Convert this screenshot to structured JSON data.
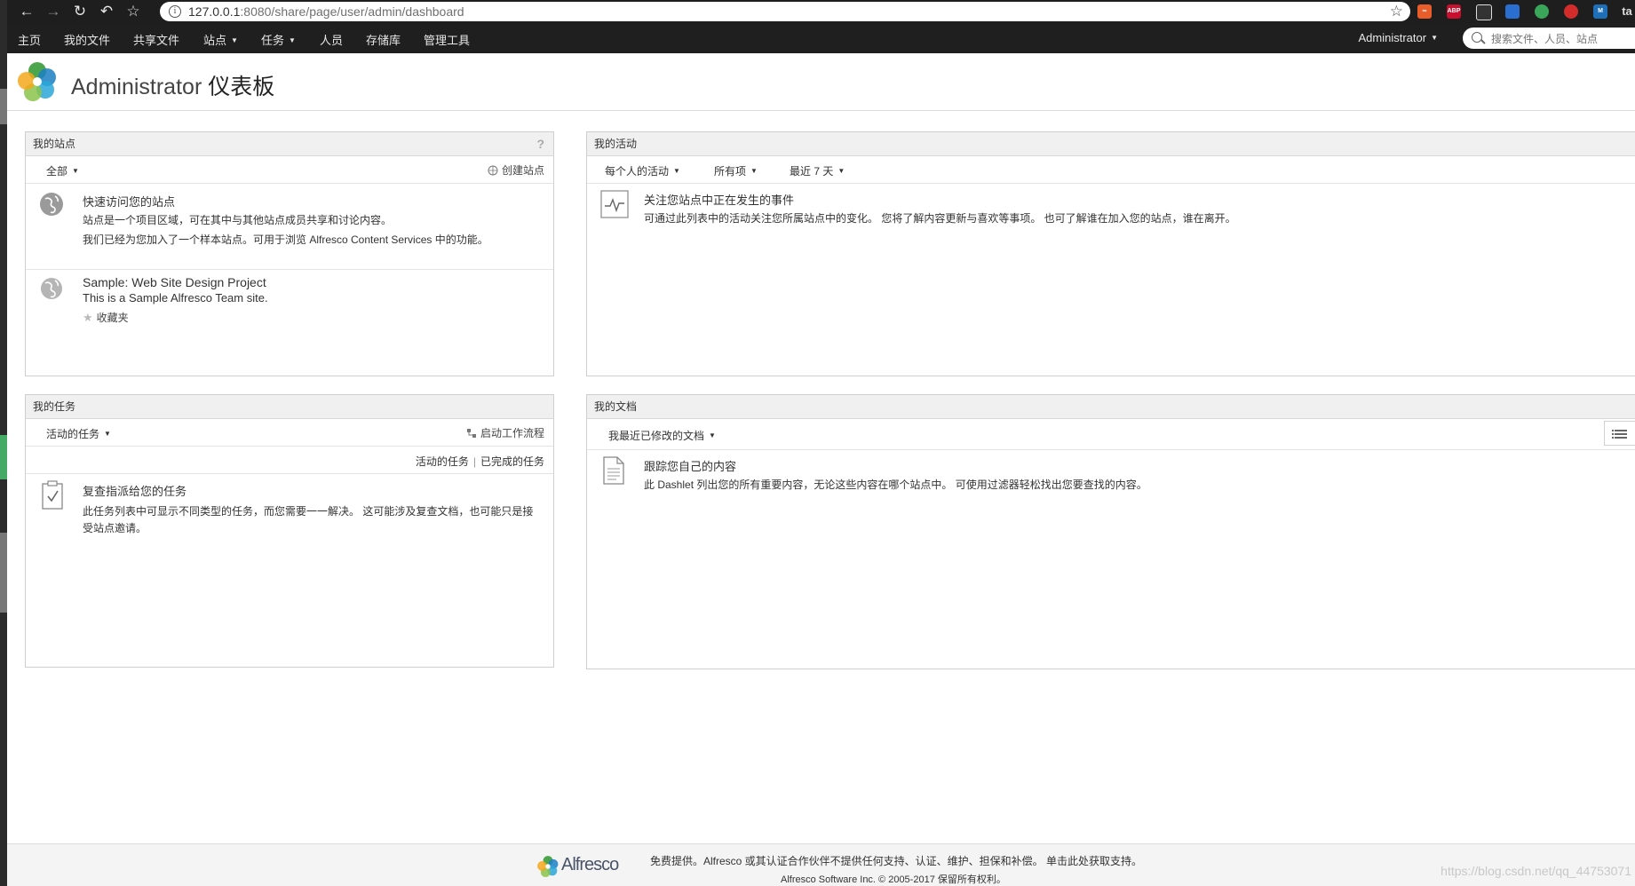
{
  "browser": {
    "url_host": "127.0.0.1",
    "url_path": ":8080/share/page/user/admin/dashboard",
    "ext_labels": [
      "∞",
      "ABP",
      "",
      "",
      "",
      "",
      "M",
      "ta"
    ]
  },
  "nav": {
    "items": [
      {
        "label": "主页"
      },
      {
        "label": "我的文件"
      },
      {
        "label": "共享文件"
      },
      {
        "label": "站点"
      },
      {
        "label": "任务"
      },
      {
        "label": "人员"
      },
      {
        "label": "存储库"
      },
      {
        "label": "管理工具"
      }
    ],
    "user": "Administrator",
    "search_placeholder": "搜索文件、人员、站点"
  },
  "title": {
    "user": "Administrator",
    "dashboard": "仪表板"
  },
  "my_sites": {
    "title": "我的站点",
    "help": "?",
    "filter": "全部",
    "create": "创建站点",
    "info_title": "快速访问您的站点",
    "info_desc1": "站点是一个项目区域，可在其中与其他站点成员共享和讨论内容。",
    "info_desc2": "我们已经为您加入了一个样本站点。可用于浏览 Alfresco Content Services 中的功能。",
    "site_name": "Sample: Web Site Design Project",
    "site_desc": "This is a Sample Alfresco Team site.",
    "favorite": "收藏夹"
  },
  "my_activities": {
    "title": "我的活动",
    "filter1": "每个人的活动",
    "filter2": "所有项",
    "filter3": "最近 7 天",
    "info_title": "关注您站点中正在发生的事件",
    "info_desc": "可通过此列表中的活动关注您所属站点中的变化。 您将了解内容更新与喜欢等事项。 也可了解谁在加入您的站点，谁在离开。"
  },
  "my_tasks": {
    "title": "我的任务",
    "filter": "活动的任务",
    "start": "启动工作流程",
    "tab_active": "活动的任务",
    "tab_completed": "已完成的任务",
    "info_title": "复查指派给您的任务",
    "info_desc": "此任务列表中可显示不同类型的任务，而您需要一一解决。 这可能涉及复查文档，也可能只是接受站点邀请。"
  },
  "my_documents": {
    "title": "我的文档",
    "filter": "我最近已修改的文档",
    "info_title": "跟踪您自己的内容",
    "info_desc": "此 Dashlet 列出您的所有重要内容，无论这些内容在哪个站点中。 可使用过滤器轻松找出您要查找的内容。"
  },
  "footer": {
    "brand": "Alfresco",
    "line1": "免费提供。Alfresco 或其认证合作伙伴不提供任何支持、认证、维护、担保和补偿。 单击此处获取支持。",
    "line2": "Alfresco Software Inc. © 2005-2017 保留所有权利。",
    "watermark": "https://blog.csdn.net/qq_44753071"
  }
}
